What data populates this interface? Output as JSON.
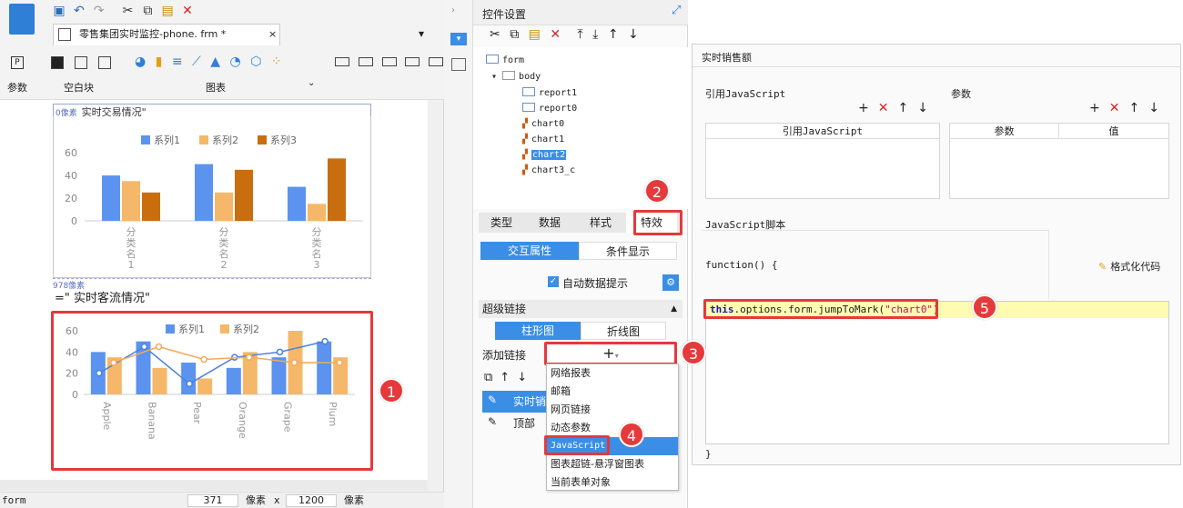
{
  "left": {
    "tab_title": "零售集团实时监控-phone. frm *",
    "tab_close": "×",
    "ribbon": {
      "param_label": "参数",
      "blank_label": "空白块",
      "chart_label": "图表"
    },
    "canvas_chart1": {
      "marker": "0像素",
      "partial_title": "实时交易情况\"",
      "legend": [
        "系列1",
        "系列2",
        "系列3"
      ],
      "colors": [
        "#5b93ef",
        "#f5b86a",
        "#c96e0f"
      ]
    },
    "marker2": "978像素",
    "title2": "=\" 实时客流情况\"",
    "status": {
      "form": "form",
      "width": "371",
      "unit1": "像素",
      "x": "x",
      "height": "1200",
      "unit2": "像素"
    }
  },
  "chart_data": [
    {
      "type": "bar",
      "categories": [
        "分类名1",
        "分类名2",
        "分类名3"
      ],
      "tick_labels": [
        "分\n类\n名\n1",
        "分\n类\n名\n2",
        "分\n类\n名\n3"
      ],
      "series": [
        {
          "name": "系列1",
          "values": [
            40,
            50,
            30
          ]
        },
        {
          "name": "系列2",
          "values": [
            35,
            25,
            15
          ]
        },
        {
          "name": "系列3",
          "values": [
            25,
            45,
            55
          ]
        }
      ],
      "yticks": [
        0,
        20,
        40,
        60
      ],
      "ylim": [
        0,
        70
      ]
    },
    {
      "type": "bar",
      "categories": [
        "Apple",
        "Banana",
        "Pear",
        "Orange",
        "Grape",
        "Plum"
      ],
      "series": [
        {
          "name": "系列1",
          "values": [
            40,
            50,
            30,
            25,
            35,
            50
          ]
        },
        {
          "name": "系列2",
          "values": [
            35,
            25,
            15,
            40,
            60,
            35
          ]
        }
      ],
      "lines": [
        {
          "name": "系列1",
          "values": [
            20,
            45,
            10,
            35,
            40,
            50
          ]
        },
        {
          "name": "系列2",
          "values": [
            30,
            45,
            33,
            35,
            30,
            30
          ]
        }
      ],
      "yticks": [
        0,
        20,
        40,
        60
      ],
      "ylim": [
        0,
        65
      ]
    }
  ],
  "mid": {
    "panel_title": "控件设置",
    "tree": [
      "form",
      "body",
      "report1",
      "report0",
      "chart0",
      "chart1",
      "chart2",
      "chart3_c"
    ],
    "tabs": [
      "类型",
      "数据",
      "样式",
      "特效"
    ],
    "subtabs": [
      "交互属性",
      "条件显示"
    ],
    "auto_tip": "自动数据提示",
    "hyperlink": "超级链接",
    "chart_tabs": [
      "柱形图",
      "折线图"
    ],
    "add_link": "添加链接",
    "plus": "+",
    "list_items": [
      "实时销",
      "顶部"
    ],
    "menu": [
      "网络报表",
      "邮箱",
      "网页链接",
      "动态参数",
      "JavaScript",
      "图表超链-悬浮窗图表",
      "当前表单对象"
    ]
  },
  "dialog": {
    "title": "实时销售额",
    "ref_js": "引用JavaScript",
    "params": "参数",
    "col_ref": "引用JavaScript",
    "col_param": "参数",
    "col_value": "值",
    "script_title": "JavaScript脚本",
    "fn_open": "function() {",
    "format_btn": "格式化代码",
    "code_this": "this",
    "code_mid": ".options.form.jumpToMark(",
    "code_str": "\"chart0\"",
    "code_end": ")",
    "fn_close": "}"
  },
  "badges": [
    "1",
    "2",
    "3",
    "4",
    "5"
  ]
}
